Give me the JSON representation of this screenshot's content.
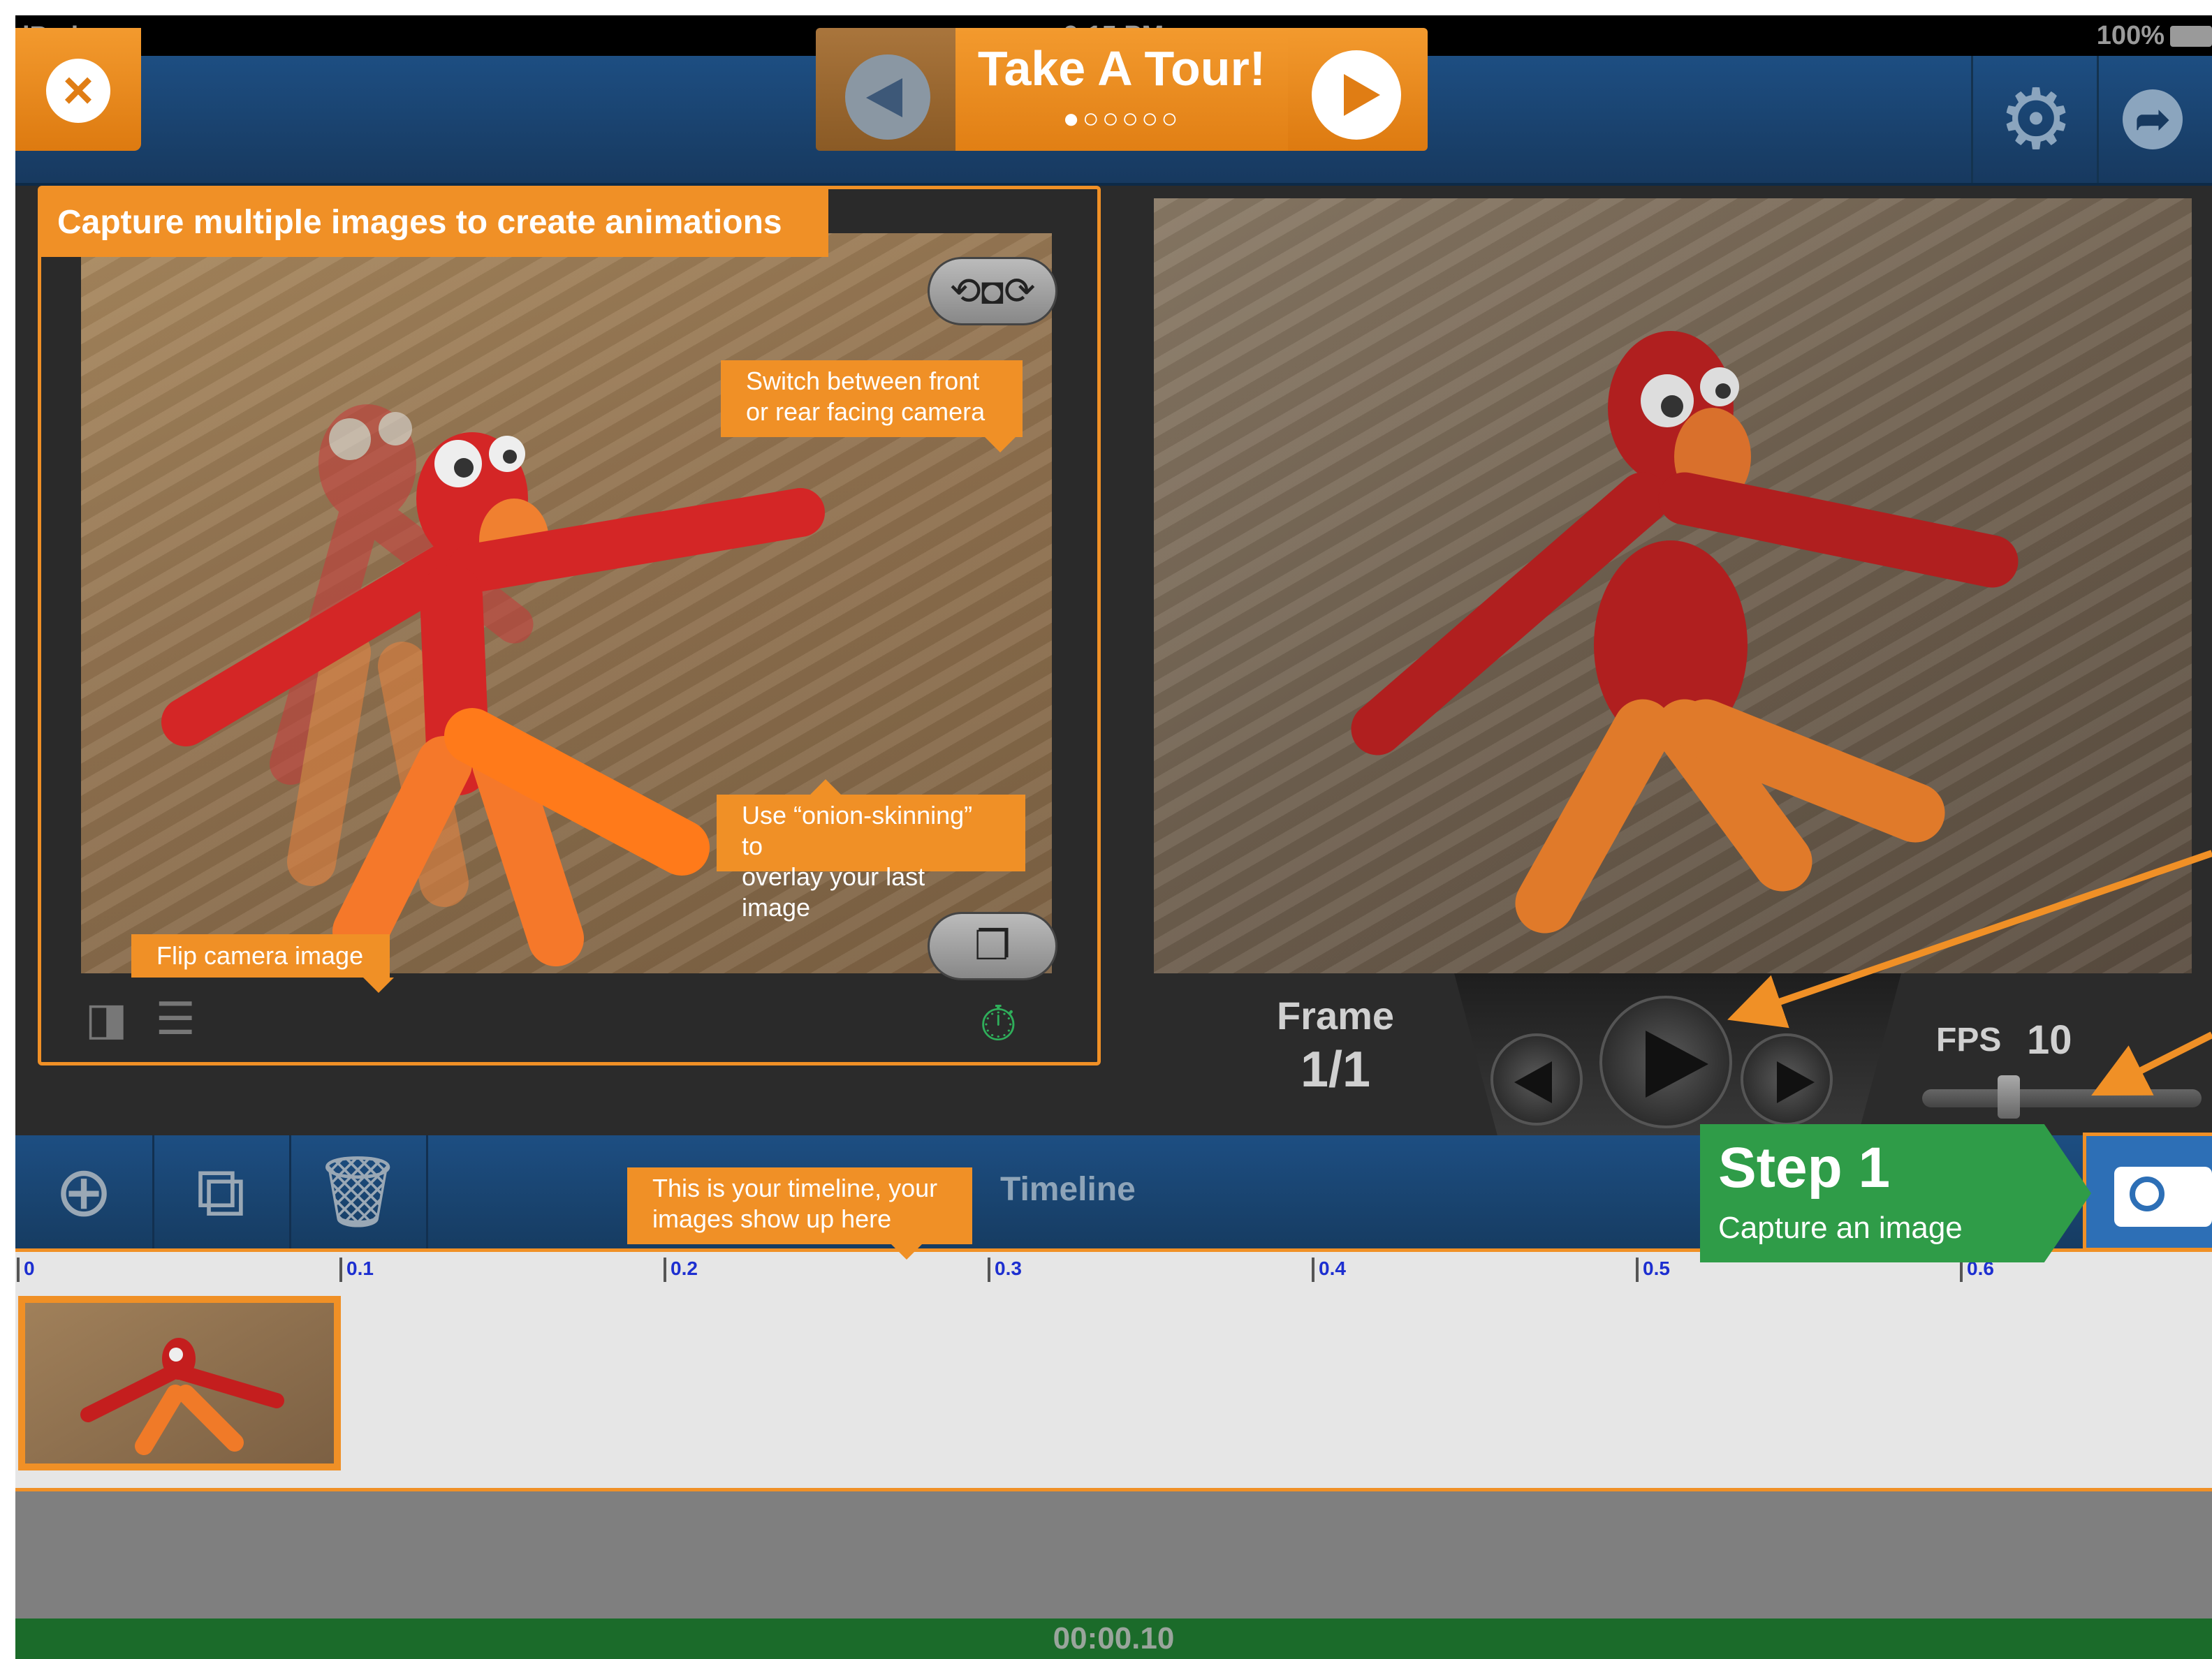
{
  "status_bar": {
    "device": "iPad",
    "time": "9:15 PM",
    "battery": "100%"
  },
  "nav": {
    "tour_title": "Take A Tour!",
    "tour_dots": "●○○○○○",
    "close_icon": "close-icon",
    "settings_icon": "gear-icon",
    "share_icon": "share-icon"
  },
  "camera_panel": {
    "banner": "Capture multiple images to create animations",
    "tip_switch_camera": "Switch between front\nor rear facing camera",
    "tip_onion_skin": "Use “onion-skinning” to\noverlay your last image",
    "tip_flip": "Flip camera image"
  },
  "preview": {
    "frame_label": "Frame",
    "frame_value": "1/1",
    "fps_label": "FPS",
    "fps_value": "10"
  },
  "toolbar": {
    "timeline_title": "Timeline",
    "tip_timeline": "This is your timeline, your\nimages show up here",
    "step_title": "Step 1",
    "step_subtitle": "Capture an image"
  },
  "ruler": {
    "ticks": [
      "0",
      "0.1",
      "0.2",
      "0.3",
      "0.4",
      "0.5",
      "0.6"
    ]
  },
  "footer": {
    "duration": "00:00.10"
  },
  "colors": {
    "accent_orange": "#f09026",
    "nav_blue": "#1d4e82",
    "step_green": "#2f9c48",
    "footer_green": "#1b6b2a"
  }
}
